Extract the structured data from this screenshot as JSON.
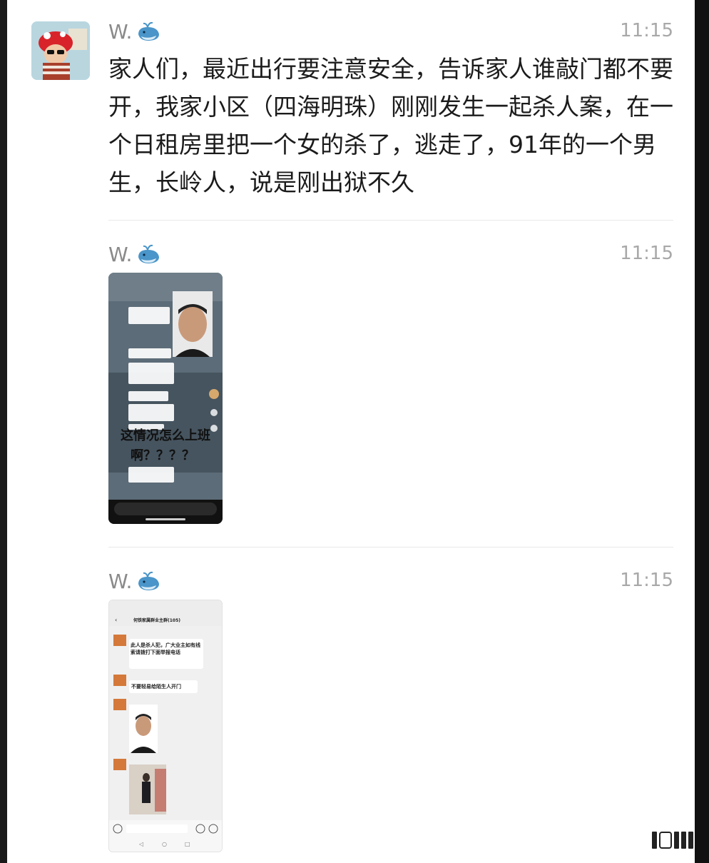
{
  "messages": [
    {
      "sender": "W.",
      "time": "11:15",
      "text": "家人们，最近出行要注意安全，告诉家人谁敲门都不要开，我家小区（四海明珠）刚刚发生一起杀人案，在一个日租房里把一个女的杀了，逃走了，91年的一个男生，长岭人，说是刚出狱不久"
    },
    {
      "sender": "W.",
      "time": "11:15",
      "image": {
        "caption_line1": "这情况怎么上班",
        "caption_line2": "啊？？？？"
      }
    },
    {
      "sender": "W.",
      "time": "11:15",
      "image": {
        "group_title": "何铁家属群业主群(105)",
        "bubble1": "此人是杀人犯，广大业主如有线索请拨打下面举报电话",
        "bubble2": "不要轻易给陌生人开门"
      }
    }
  ],
  "icons": {
    "whale": "whale-emoji-icon",
    "avatar": "avatar-photo"
  },
  "colors": {
    "page_bg": "#ffffff",
    "text": "#1b1b1b",
    "meta": "#8a8a8a"
  }
}
